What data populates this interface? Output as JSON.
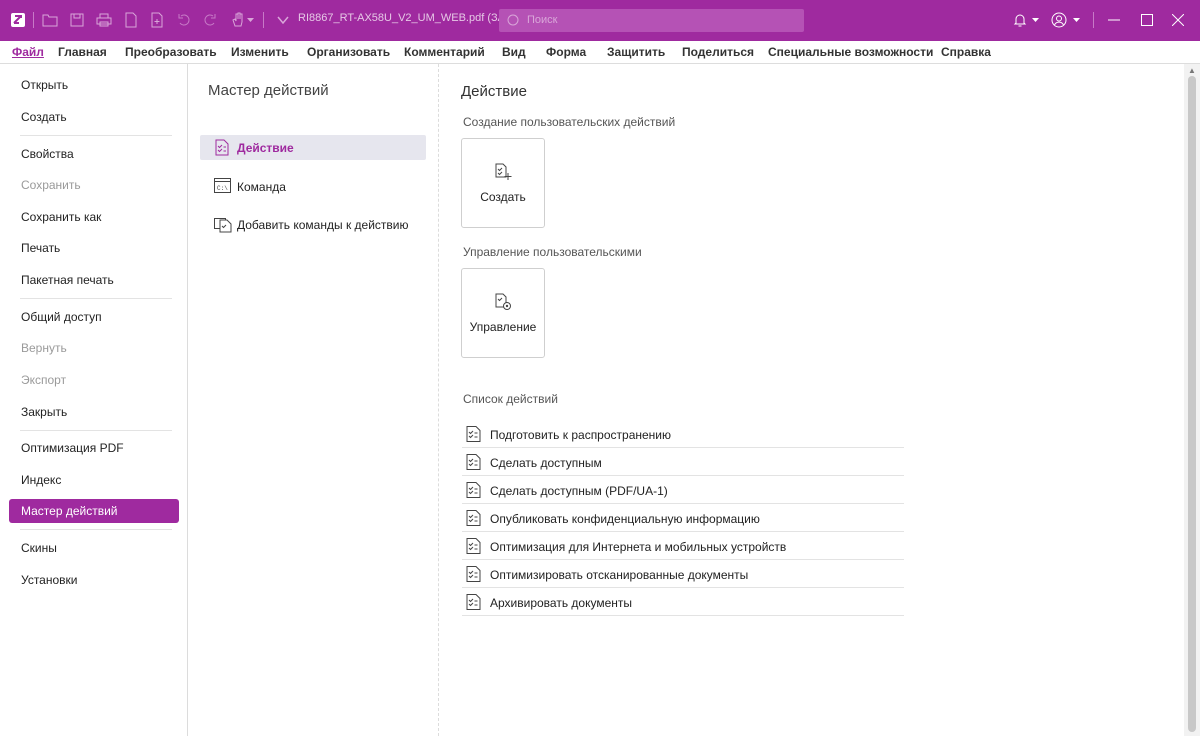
{
  "app": {
    "document_title": "RI8867_RT-AX58U_V2_UM_WEB.pdf (ЗАЩИ..."
  },
  "search": {
    "placeholder": "Поиск"
  },
  "menu": [
    "Файл",
    "Главная",
    "Преобразовать",
    "Изменить",
    "Организовать",
    "Комментарий",
    "Вид",
    "Форма",
    "Защитить",
    "Поделиться",
    "Специальные возможности",
    "Справка"
  ],
  "left_panel": [
    "Открыть",
    "Создать",
    "Свойства",
    "Сохранить",
    "Сохранить как",
    "Печать",
    "Пакетная печать",
    "Общий доступ",
    "Вернуть",
    "Экспорт",
    "Закрыть",
    "Оптимизация PDF",
    "Индекс",
    "Мастер действий",
    "Скины",
    "Установки"
  ],
  "middle": {
    "title": "Мастер действий",
    "items": [
      "Действие",
      "Команда",
      "Добавить команды к действию"
    ]
  },
  "main": {
    "title": "Действие",
    "create_section": "Создание пользовательских действий",
    "create_button": "Создать",
    "manage_section": "Управление пользовательскими",
    "manage_button": "Управление",
    "list_section": "Список действий",
    "actions": [
      "Подготовить к распространению",
      "Сделать доступным",
      "Сделать доступным (PDF/UA-1)",
      "Опубликовать конфиденциальную информацию",
      "Оптимизация для Интернета и мобильных устройств",
      "Оптимизировать отсканированные документы",
      "Архивировать документы"
    ]
  },
  "colors": {
    "accent": "#9f2a9f"
  }
}
